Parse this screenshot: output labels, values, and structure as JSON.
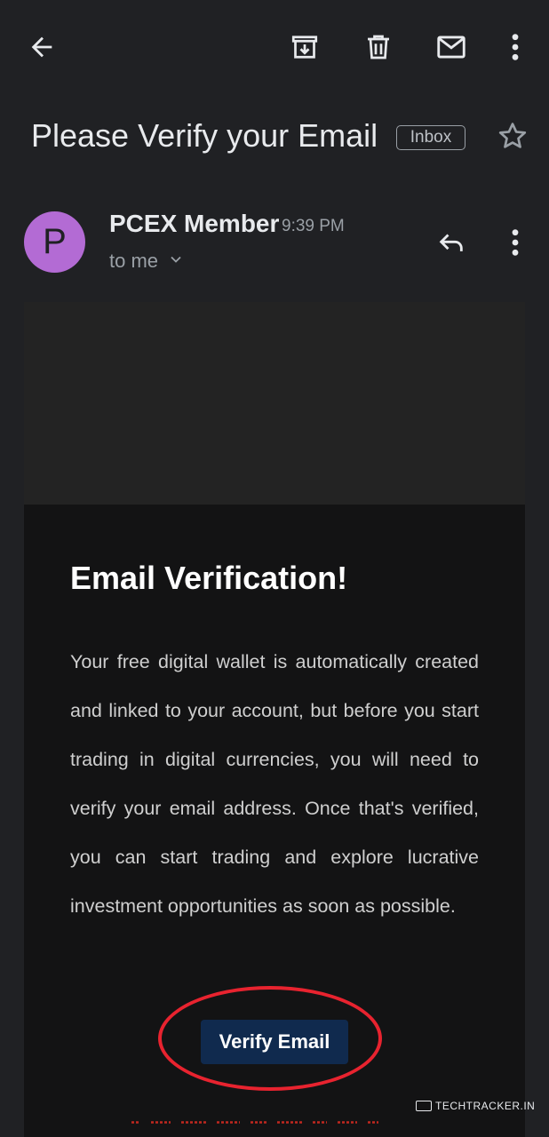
{
  "toolbar": {
    "back_icon": "arrow-left-icon",
    "archive_icon": "archive-icon",
    "delete_icon": "trash-icon",
    "mark_unread_icon": "mail-icon",
    "more_icon": "more-vert-icon"
  },
  "email": {
    "subject": "Please Verify your Email",
    "label": "Inbox",
    "star_icon": "star-icon",
    "sender": {
      "initial": "P",
      "name": "PCEX Member",
      "time": "9:39 PM",
      "recipient": "to me",
      "avatar_color": "#b36bd4"
    },
    "reply_icon": "reply-icon",
    "more_icon": "more-vert-icon"
  },
  "body": {
    "title": "Email Verification!",
    "paragraph": "Your free digital wallet is automatically created and linked to your account, but before you start trading in digital currencies, you will need to verify your email address. Once that's verified, you can start trading and explore lucrative investment opportunities as soon as possible.",
    "button_label": "Verify Email",
    "button_color": "#102a4e",
    "highlight_color": "#e8232f"
  },
  "watermark": "TECHTRACKER.IN"
}
